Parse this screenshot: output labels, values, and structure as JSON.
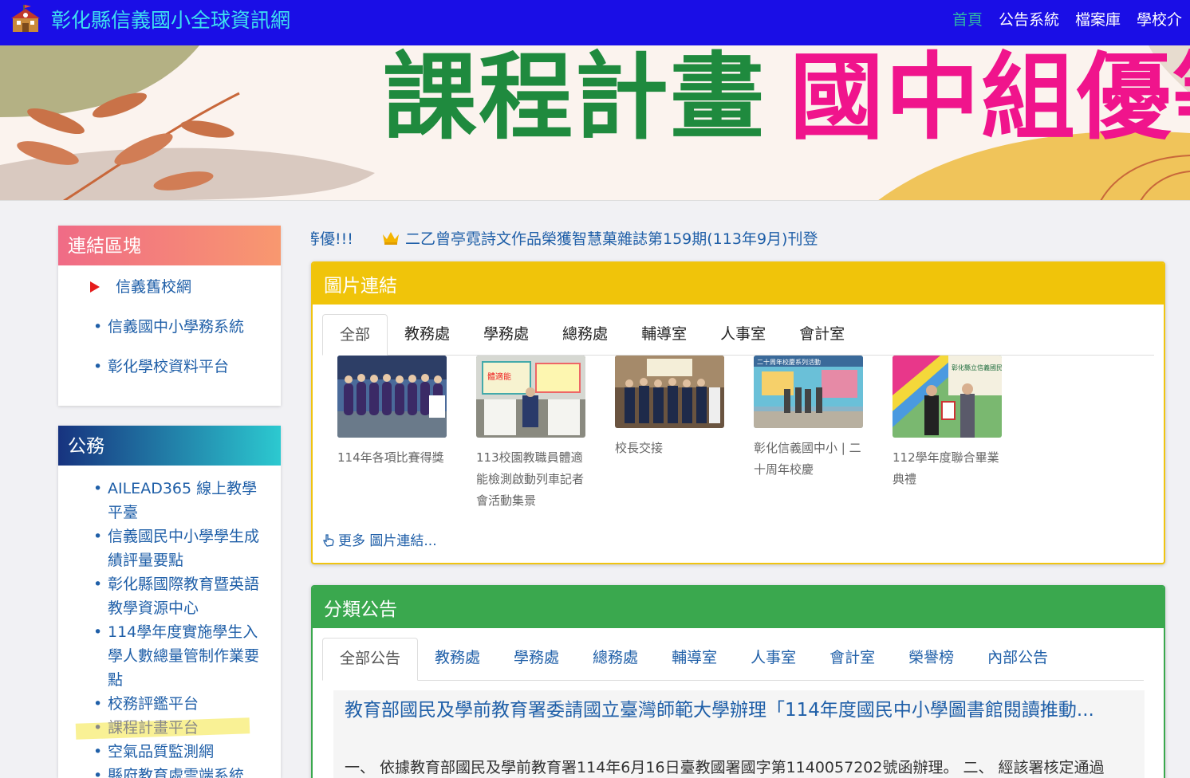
{
  "header": {
    "site_title": "彰化縣信義國小全球資訊網",
    "nav": [
      "首頁",
      "公告系統",
      "檔案庫",
      "學校介"
    ]
  },
  "banner": {
    "text_green": "課程計畫",
    "text_pink": "國中組優等"
  },
  "sidebar": {
    "links_panel": {
      "title": "連結區塊",
      "items": [
        "信義舊校網",
        "信義國中小學務系統",
        "彰化學校資料平台"
      ]
    },
    "affairs_panel": {
      "title": "公務",
      "items": [
        "AILEAD365 線上教學平臺",
        "信義國民中小學學生成績評量要點",
        "彰化縣國際教育暨英語教學資源中心",
        "114學年度實施學生入學人數總量管制作業要點",
        "校務評鑑平台",
        "課程計畫平台",
        "空氣品質監測網",
        "縣府教育處雲端系統"
      ]
    }
  },
  "marquee": {
    "prev_fragment": "等優!!!",
    "current": "二乙曾亭霓詩文作品榮獲智慧菓雜誌第159期(113年9月)刊登"
  },
  "photo_links": {
    "title": "圖片連結",
    "tabs": [
      "全部",
      "教務處",
      "學務處",
      "總務處",
      "輔導室",
      "人事室",
      "會計室"
    ],
    "items": [
      {
        "caption": "114年各項比賽得獎"
      },
      {
        "caption": "113校園教職員體適能檢測啟動列車記者會活動集景",
        "thumb_text": "體適能"
      },
      {
        "caption": "校長交接"
      },
      {
        "caption": "彰化信義國中小 | 二十周年校慶",
        "thumb_text": "二十周年校慶系列活動"
      },
      {
        "caption": "112學年度聯合畢業典禮",
        "thumb_text": "彰化縣立信義國民中"
      }
    ],
    "more": "更多 圖片連結..."
  },
  "announcements": {
    "title": "分類公告",
    "tabs": [
      "全部公告",
      "教務處",
      "學務處",
      "總務處",
      "輔導室",
      "人事室",
      "會計室",
      "榮譽榜",
      "內部公告"
    ],
    "top_title": "教育部國民及學前教育署委請國立臺灣師範大學辦理「114年度國民中小學圖書館閱讀推動...",
    "top_body": "一、 依據教育部國民及學前教育署114年6月16日臺教國署國字第1140057202號函辦理。 二、 經該署核定通過"
  },
  "colors": {
    "topbar": "#1a0ee6",
    "title": "#3ee0f0",
    "link": "#1f5fa8",
    "photo_head": "#f0c40a",
    "ann_head": "#3aa84e"
  }
}
